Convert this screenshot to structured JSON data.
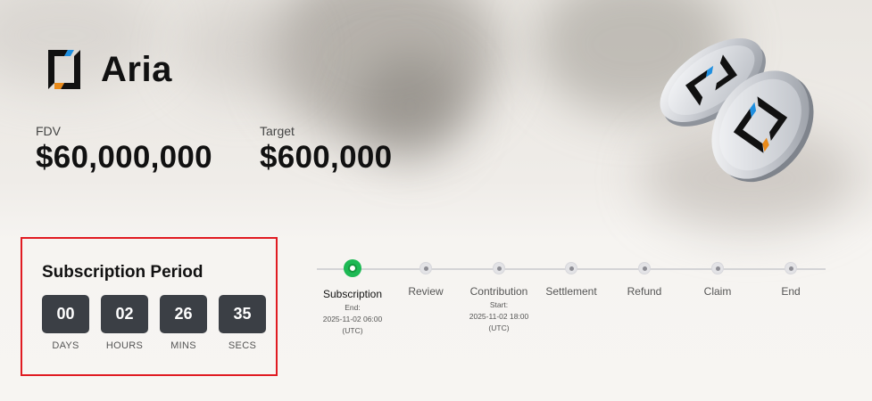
{
  "project": {
    "name": "Aria",
    "logo_icon": "aria-logo-icon"
  },
  "stats": [
    {
      "label": "FDV",
      "value": "$60,000,000"
    },
    {
      "label": "Target",
      "value": "$600,000"
    }
  ],
  "countdown": {
    "title": "Subscription Period",
    "units": [
      {
        "value": "00",
        "label": "DAYS"
      },
      {
        "value": "02",
        "label": "HOURS"
      },
      {
        "value": "26",
        "label": "MINS"
      },
      {
        "value": "35",
        "label": "SECS"
      }
    ]
  },
  "timeline": {
    "steps": [
      {
        "label": "Subscription",
        "active": true,
        "detail": [
          "End:",
          "2025-11-02 06:00",
          "(UTC)"
        ]
      },
      {
        "label": "Review"
      },
      {
        "label": "Contribution",
        "detail": [
          "Start:",
          "2025-11-02 18:00",
          "(UTC)"
        ]
      },
      {
        "label": "Settlement"
      },
      {
        "label": "Refund"
      },
      {
        "label": "Claim"
      },
      {
        "label": "End"
      }
    ]
  },
  "colors": {
    "active": "#1db954",
    "highlight_border": "#e01b22",
    "timer_box": "#3b3f45"
  }
}
